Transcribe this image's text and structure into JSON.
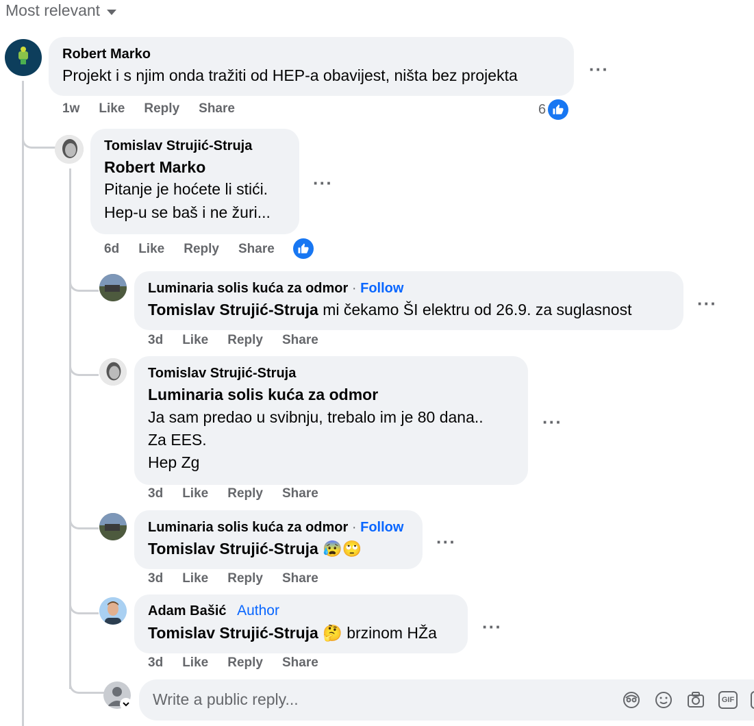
{
  "sort": {
    "label": "Most relevant"
  },
  "comments": [
    {
      "author": "Robert Marko",
      "text": "Projekt i s njim onda tražiti od HEP-a obavijest, ništa bez projekta",
      "time": "1w",
      "like": "Like",
      "reply": "Reply",
      "share": "Share",
      "reaction_count": "6"
    },
    {
      "author": "Tomislav Strujić-Struja",
      "mention": "Robert Marko",
      "lines": [
        "Pitanje je hoćete li stići.",
        "Hep-u se baš i ne žuri..."
      ],
      "time": "6d",
      "like": "Like",
      "reply": "Reply",
      "share": "Share"
    },
    {
      "author": "Luminaria solis kuća za odmor",
      "separator": "·",
      "follow": "Follow",
      "mention": "Tomislav Strujić-Struja",
      "text": "mi čekamo ŠI elektru od 26.9. za suglasnost",
      "time": "3d",
      "like": "Like",
      "reply": "Reply",
      "share": "Share"
    },
    {
      "author": "Tomislav Strujić-Struja",
      "mention": "Luminaria solis kuća za odmor",
      "lines": [
        "Ja sam predao u svibnju, trebalo im je 80 dana..",
        "Za EES.",
        "Hep Zg"
      ],
      "time": "3d",
      "like": "Like",
      "reply": "Reply",
      "share": "Share"
    },
    {
      "author": "Luminaria solis kuća za odmor",
      "separator": "·",
      "follow": "Follow",
      "mention": "Tomislav Strujić-Struja",
      "emoji": "😰🙄",
      "time": "3d",
      "like": "Like",
      "reply": "Reply",
      "share": "Share"
    },
    {
      "author": "Adam Bašić",
      "badge": "Author",
      "mention": "Tomislav Strujić-Struja",
      "emoji": "🤔",
      "text": "brzinom HŽa",
      "time": "3d",
      "like": "Like",
      "reply": "Reply",
      "share": "Share"
    }
  ],
  "more_glyph": "···",
  "reply_box": {
    "placeholder": "Write a public reply...",
    "gif_label": "GIF"
  },
  "colors": {
    "accent": "#0866ff",
    "like_blue": "#1877f2",
    "bubble": "#f0f2f5",
    "muted": "#65676b"
  }
}
